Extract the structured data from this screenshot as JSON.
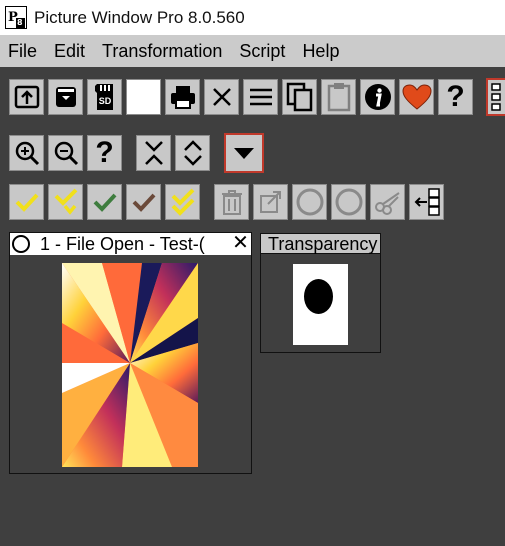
{
  "window": {
    "title": "Picture Window Pro 8.0.560",
    "logo_text": "P",
    "logo_sub": "8"
  },
  "menu": {
    "items": [
      "File",
      "Edit",
      "Transformation",
      "Script",
      "Help"
    ]
  },
  "toolbar1": {
    "icons": [
      "open-icon",
      "save-icon",
      "sd-card-icon",
      "blank-icon",
      "print-icon",
      "close-icon",
      "menu-icon",
      "copy-icon",
      "paste-icon",
      "info-icon",
      "heart-icon",
      "help-icon",
      "panel-toggle-icon"
    ],
    "sd_label": "SD",
    "help_label": "?"
  },
  "toolbar2": {
    "icons": [
      "zoom-in-icon",
      "zoom-out-icon",
      "help-icon",
      "collapse-icon",
      "expand-icon",
      "dropdown-icon"
    ],
    "help_label": "?"
  },
  "toolbar3": {
    "icons": [
      "check-yellow-icon",
      "check-yellow-down-icon",
      "check-green-icon",
      "check-brown-icon",
      "double-check-icon",
      "trash-icon",
      "export-icon",
      "circle-icon",
      "circle-icon",
      "scissors-icon",
      "insert-left-icon"
    ]
  },
  "document_window": {
    "title": "1 - File Open - Test-(",
    "close_label": "✕"
  },
  "transparency_window": {
    "title": "Transparency"
  },
  "colors": {
    "background": "#3f3f3f",
    "menubar": "#cbcbcb",
    "button": "#c8c8c8",
    "accent_red": "#c0392b",
    "check_yellow": "#f1e01b",
    "check_green": "#3e7d3e",
    "check_brown": "#6b4a3a",
    "heart": "#e04a1a"
  }
}
